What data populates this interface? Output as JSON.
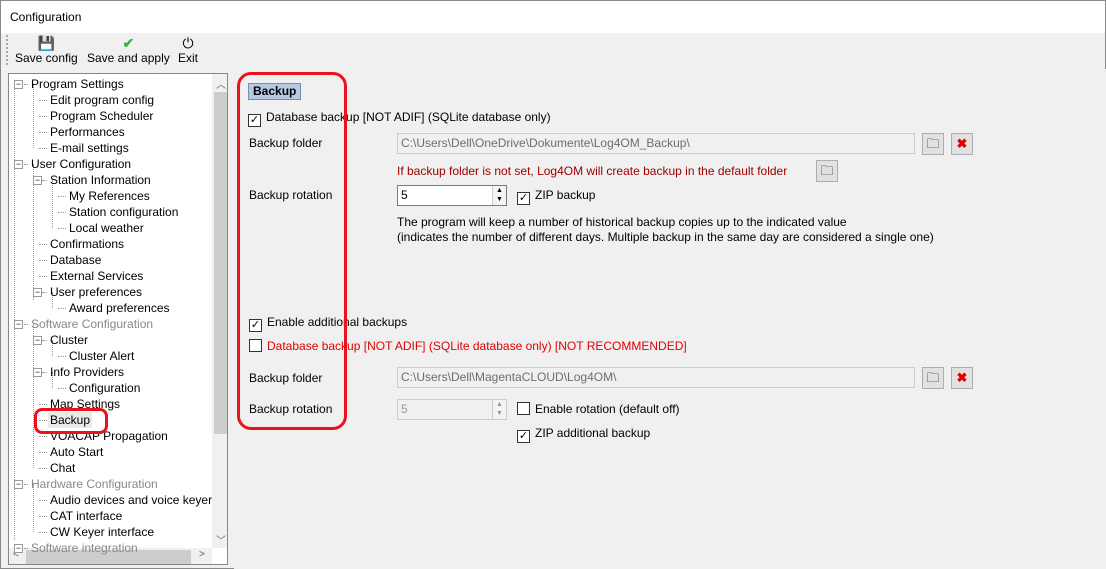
{
  "window": {
    "title": "Configuration"
  },
  "toolbar": {
    "save_config": "Save config",
    "save_apply": "Save and apply",
    "exit": "Exit"
  },
  "tree": [
    {
      "label": "Program Settings",
      "level": 0,
      "expander": true,
      "gray": false
    },
    {
      "label": "Edit program config",
      "level": 1
    },
    {
      "label": "Program Scheduler",
      "level": 1
    },
    {
      "label": "Performances",
      "level": 1
    },
    {
      "label": "E-mail settings",
      "level": 1
    },
    {
      "label": "User Configuration",
      "level": 0,
      "expander": true
    },
    {
      "label": "Station Information",
      "level": 1,
      "expander": true
    },
    {
      "label": "My References",
      "level": 2
    },
    {
      "label": "Station configuration",
      "level": 2
    },
    {
      "label": "Local weather",
      "level": 2
    },
    {
      "label": "Confirmations",
      "level": 1
    },
    {
      "label": "Database",
      "level": 1
    },
    {
      "label": "External Services",
      "level": 1
    },
    {
      "label": "User preferences",
      "level": 1,
      "expander": true
    },
    {
      "label": "Award preferences",
      "level": 2
    },
    {
      "label": "Software Configuration",
      "level": 0,
      "expander": true,
      "gray": true
    },
    {
      "label": "Cluster",
      "level": 1,
      "expander": true
    },
    {
      "label": "Cluster Alert",
      "level": 2
    },
    {
      "label": "Info Providers",
      "level": 1,
      "expander": true
    },
    {
      "label": "Configuration",
      "level": 2
    },
    {
      "label": "Map Settings",
      "level": 1
    },
    {
      "label": "Backup",
      "level": 1,
      "selected": true
    },
    {
      "label": "VOACAP Propagation",
      "level": 1
    },
    {
      "label": "Auto Start",
      "level": 1
    },
    {
      "label": "Chat",
      "level": 1
    },
    {
      "label": "Hardware Configuration",
      "level": 0,
      "expander": true,
      "gray": true
    },
    {
      "label": "Audio devices and voice keyer",
      "level": 1
    },
    {
      "label": "CAT interface",
      "level": 1
    },
    {
      "label": "CW Keyer interface",
      "level": 1
    },
    {
      "label": "Software integration",
      "level": 0,
      "expander": true,
      "gray": true
    }
  ],
  "backup": {
    "header": "Backup",
    "db_backup": {
      "label": "Database backup [NOT ADIF] (SQLite database only)",
      "checked": true
    },
    "folder_label": "Backup folder",
    "folder_value": "C:\\Users\\Dell\\OneDrive\\Dokumente\\Log4OM_Backup\\",
    "default_note": "If backup folder is not set, Log4OM will create backup in the default folder",
    "rotation_label": "Backup rotation",
    "rotation_value": "5",
    "zip": {
      "label": "ZIP backup",
      "checked": true
    },
    "info_line1": "The program will keep a number of historical backup copies up to the indicated value",
    "info_line2": "(indicates the number of different days. Multiple backup in the same day are considered a single one)"
  },
  "additional": {
    "enable": {
      "label": "Enable additional backups",
      "checked": true
    },
    "db_backup": {
      "label": "Database backup [NOT ADIF] (SQLite database only) [NOT RECOMMENDED]",
      "checked": false
    },
    "folder_label": "Backup folder",
    "folder_value": "C:\\Users\\Dell\\MagentaCLOUD\\Log4OM\\",
    "rotation_label": "Backup rotation",
    "rotation_value": "5",
    "enable_rotation": {
      "label": "Enable rotation (default off)",
      "checked": false
    },
    "zip": {
      "label": "ZIP additional backup",
      "checked": true
    }
  },
  "colors": {
    "annotation": "#e8141c",
    "warning_text": "#a00000",
    "red_text": "#e00000",
    "header_bg": "#b7c9e2"
  }
}
